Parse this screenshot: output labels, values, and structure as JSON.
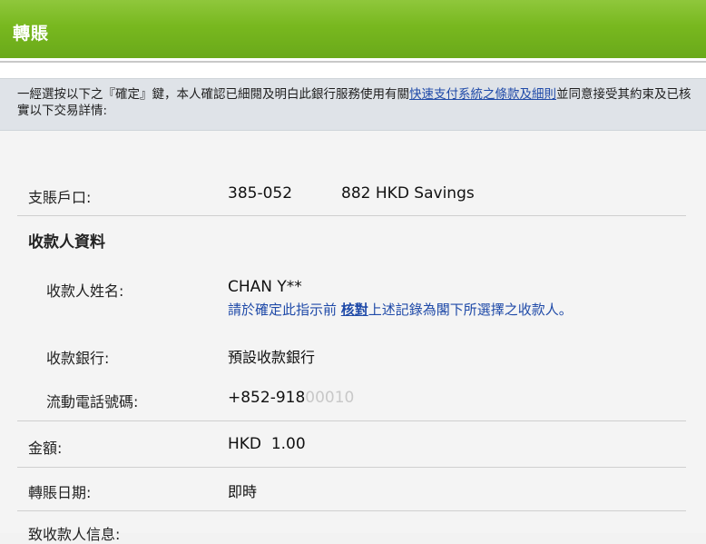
{
  "header": {
    "title": "轉賬"
  },
  "notice": {
    "text_before": "一經選按以下之『確定』鍵，本人確認已細閱及明白此銀行服務使用有關",
    "link": "快速支付系統之條款及細則",
    "text_after": "並同意接受其約束及已核實以下交易詳情:"
  },
  "details": {
    "debit_account": {
      "label": "支賬戶口:",
      "value_prefix": "385-052",
      "value_suffix": "882 HKD Savings"
    },
    "payee_section": {
      "title": "收款人資料"
    },
    "payee_name": {
      "label": "收款人姓名:",
      "value": "CHAN Y**"
    },
    "verify_note": {
      "before": "請於確定此指示前 ",
      "emphasis": "核對",
      "after": "上述記錄為閣下所選擇之收款人。"
    },
    "payee_bank": {
      "label": "收款銀行:",
      "value": "預設收款銀行"
    },
    "mobile": {
      "label": "流動電話號碼:",
      "value_visible": "+852-918",
      "value_obscured": "00010"
    },
    "amount": {
      "label": "金額:",
      "value": "HKD  1.00"
    },
    "transfer_date": {
      "label": "轉賬日期:",
      "value": "即時"
    },
    "message": {
      "label": "致收款人信息:"
    }
  }
}
